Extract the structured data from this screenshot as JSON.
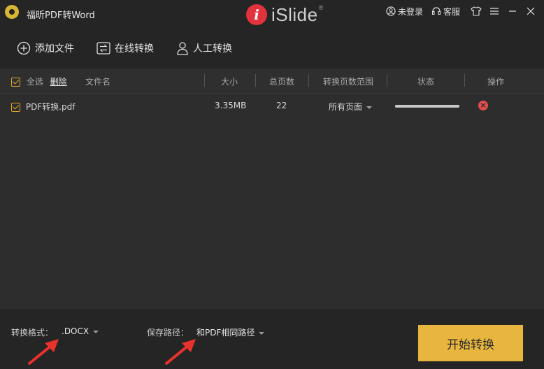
{
  "app": {
    "title": "福昕PDF转Word",
    "brand": "iSlide",
    "brand_mark": "®"
  },
  "title_actions": {
    "login": "未登录",
    "service": "客服"
  },
  "toolbar": {
    "add_file": "添加文件",
    "online_convert": "在线转换",
    "manual_convert": "人工转换"
  },
  "table": {
    "select_all": "全选",
    "delete": "删除",
    "headers": {
      "filename": "文件名",
      "size": "大小",
      "pages": "总页数",
      "range": "转换页数范围",
      "status": "状态",
      "ops": "操作"
    },
    "rows": [
      {
        "filename": "PDF转换.pdf",
        "size": "3.35MB",
        "pages": "22",
        "range": "所有页面",
        "progress": 1.0
      }
    ]
  },
  "bottom": {
    "format_label": "转换格式：",
    "format_value": ".DOCX",
    "path_label": "保存路径：",
    "path_value": "和PDF相同路径",
    "start": "开始转换"
  },
  "colors": {
    "accent": "#e8b63f",
    "danger": "#e24d4d",
    "annotation_arrow": "#e8322c"
  }
}
